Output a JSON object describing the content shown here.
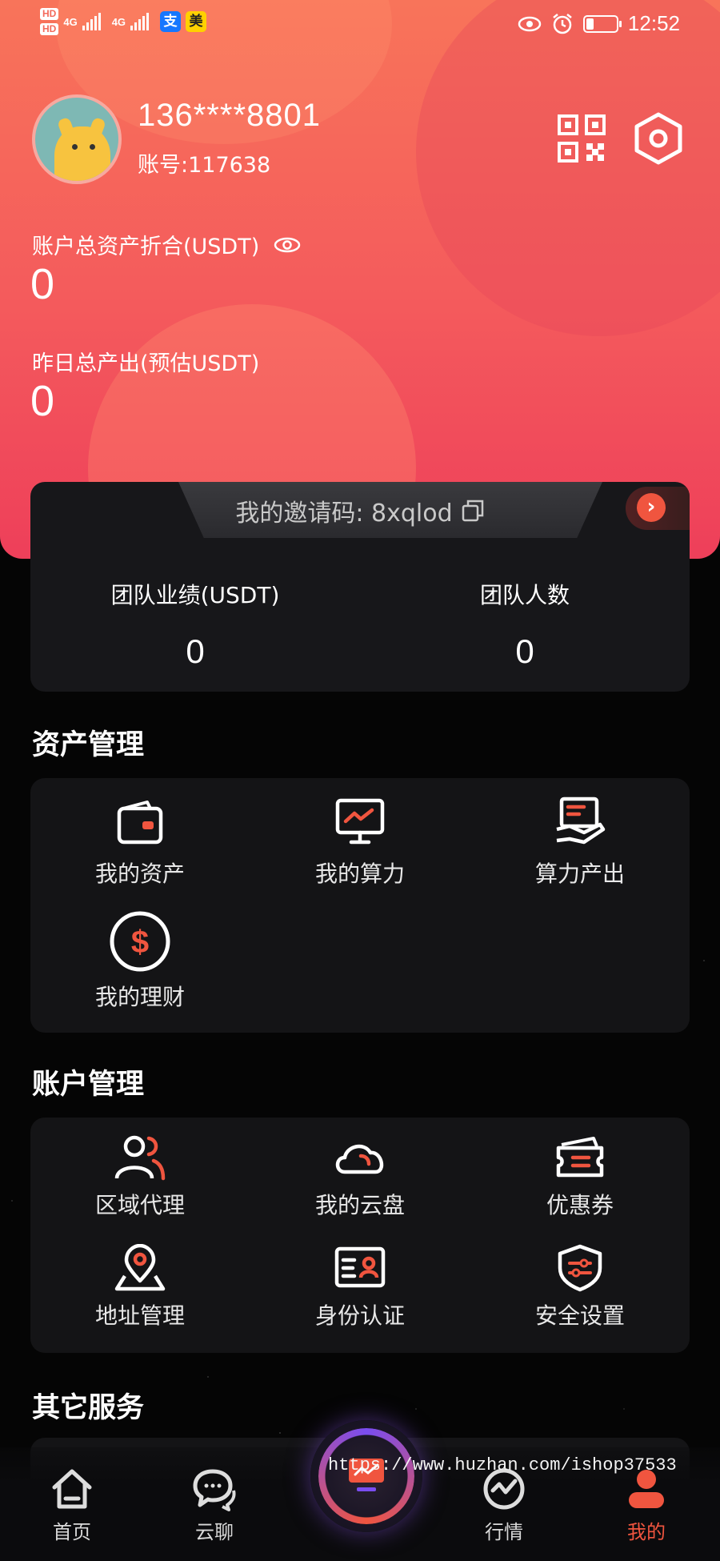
{
  "status_bar": {
    "hd1": "HD",
    "hd2": "HD",
    "sig1": "4G",
    "sig2": "4G",
    "app1": "支",
    "app2": "美",
    "time": "12:52"
  },
  "profile": {
    "phone": "136****8801",
    "account": "账号:117638"
  },
  "assets": {
    "total_label": "账户总资产折合(USDT)",
    "total_value": "0",
    "yesterday_label": "昨日总产出(预估USDT)",
    "yesterday_value": "0"
  },
  "team": {
    "invite_text": "我的邀请码: 8xqlod",
    "performance_label": "团队业绩(USDT)",
    "performance_value": "0",
    "members_label": "团队人数",
    "members_value": "0"
  },
  "sections": {
    "asset_management": {
      "title": "资产管理",
      "items": [
        {
          "label": "我的资产",
          "icon": "wallet-icon"
        },
        {
          "label": "我的算力",
          "icon": "monitor-chart-icon"
        },
        {
          "label": "算力产出",
          "icon": "hand-receipt-icon"
        },
        {
          "label": "我的理财",
          "icon": "dollar-circle-icon"
        }
      ]
    },
    "account_management": {
      "title": "账户管理",
      "items": [
        {
          "label": "区域代理",
          "icon": "users-icon"
        },
        {
          "label": "我的云盘",
          "icon": "cloud-icon"
        },
        {
          "label": "优惠券",
          "icon": "coupon-icon"
        },
        {
          "label": "地址管理",
          "icon": "location-pin-icon"
        },
        {
          "label": "身份认证",
          "icon": "id-card-icon"
        },
        {
          "label": "安全设置",
          "icon": "shield-icon"
        }
      ]
    },
    "other_services": {
      "title": "其它服务"
    }
  },
  "bottom_nav": {
    "items": [
      {
        "label": "首页",
        "icon": "home-icon"
      },
      {
        "label": "云聊",
        "icon": "chat-icon"
      },
      {
        "label": "",
        "icon": "center-monitor-icon"
      },
      {
        "label": "行情",
        "icon": "market-icon"
      },
      {
        "label": "我的",
        "icon": "profile-icon"
      }
    ],
    "active_index": 4
  },
  "watermark": "https://www.huzhan.com/ishop37533",
  "colors": {
    "accent": "#f0553f",
    "header_top": "#f8745a",
    "header_bottom": "#ee3f5a",
    "card_bg": "#17171a",
    "page_bg": "#050505"
  }
}
